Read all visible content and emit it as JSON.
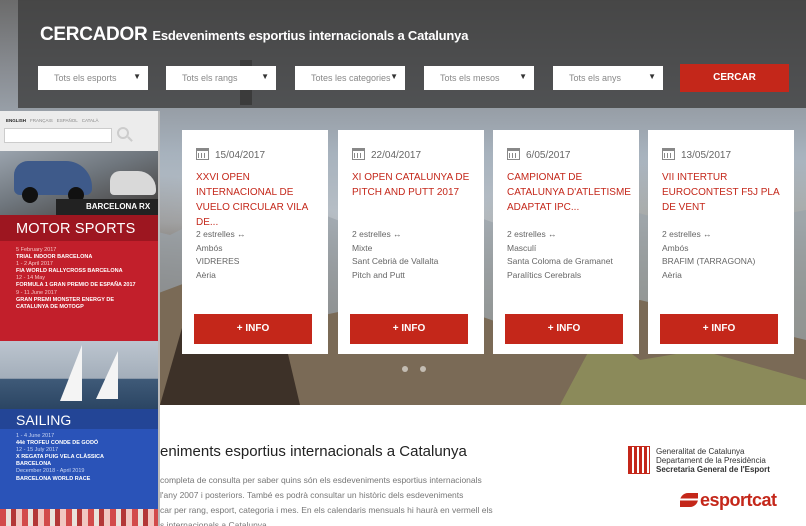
{
  "search": {
    "title": "CERCADOR",
    "subtitle": "Esdeveniments esportius internacionals a Catalunya",
    "filters": [
      "Tots els esports",
      "Tots els rangs",
      "Totes les categories",
      "Tots els mesos",
      "Tots els anys"
    ],
    "button": "CERCAR"
  },
  "events": [
    {
      "date": "15/04/2017",
      "title": "XXVI OPEN INTERNACIONAL DE VUELO CIRCULAR VILA DE...",
      "rank": "2 estrelles ↔",
      "gender": "Ambós",
      "place": "VIDRERES",
      "sport": "Aèria",
      "button": "+ INFO"
    },
    {
      "date": "22/04/2017",
      "title": "XI OPEN CATALUNYA DE PITCH AND PUTT 2017",
      "rank": "2 estrelles ↔",
      "gender": "Mixte",
      "place": "Sant Cebrià de Vallalta",
      "sport": "Pitch and Putt",
      "button": "+ INFO"
    },
    {
      "date": "6/05/2017",
      "title": "CAMPIONAT DE CATALUNYA D'ATLETISME ADAPTAT IPC...",
      "rank": "2 estrelles ↔",
      "gender": "Masculí",
      "place": "Santa Coloma de Gramanet",
      "sport": "Paralítics Cerebrals",
      "button": "+ INFO"
    },
    {
      "date": "13/05/2017",
      "title": "VII INTERTUR EUROCONTEST F5J PLA DE VENT",
      "rank": "2 estrelles ↔",
      "gender": "Ambós",
      "place": "BRAFIM (TARRAGONA)",
      "sport": "Aèria",
      "button": "+ INFO"
    }
  ],
  "intro": {
    "title": "eniments esportius internacionals a Catalunya",
    "lines": [
      "completa de consulta per saber quins són els esdeveniments esportius internacionals",
      "l'any 2007 i posteriors. També es podrà consultar un històric dels esdeveniments",
      "car per rang, esport, categoria i mes. En els calendaris mensuals hi haurà en vermell els",
      "s internacionals a Catalunya"
    ]
  },
  "gencat": {
    "line1": "Generalitat de Catalunya",
    "line2": "Departament de la Presidència",
    "line3": "Secretaria General de l'Esport"
  },
  "esportcat": "esportcat",
  "sidepanel": {
    "languages": [
      "ENGLISH",
      "FRANÇAIS",
      "ESPAÑOL",
      "CATALÀ"
    ],
    "moto_banner": "BARCELONA RX",
    "moto": {
      "heading": "MOTOR SPORTS",
      "events": [
        {
          "date": "5 February 2017",
          "name": "TRIAL INDOOR BARCELONA"
        },
        {
          "date": "1 - 2 April 2017",
          "name": "FIA WORLD RALLYCROSS BARCELONA"
        },
        {
          "date": "12 - 14 May",
          "name": "FORMULA 1 GRAN PREMIO DE ESPAÑA 2017"
        },
        {
          "date": "9 - 11 June 2017",
          "name": "GRAN PREMI MONSTER ENERGY DE CATALUNYA DE MOTOGP"
        }
      ]
    },
    "sail": {
      "heading": "SAILING",
      "events": [
        {
          "date": "1 - 4 June 2017",
          "name": "44è TROFEU CONDE DE GODÓ"
        },
        {
          "date": "12 - 15 July 2017",
          "name": "X REGATA PUIG VELA CLÀSSICA BARCELONA"
        },
        {
          "date": "December 2018 - April 2019",
          "name": "BARCELONA WORLD RACE"
        }
      ]
    }
  }
}
